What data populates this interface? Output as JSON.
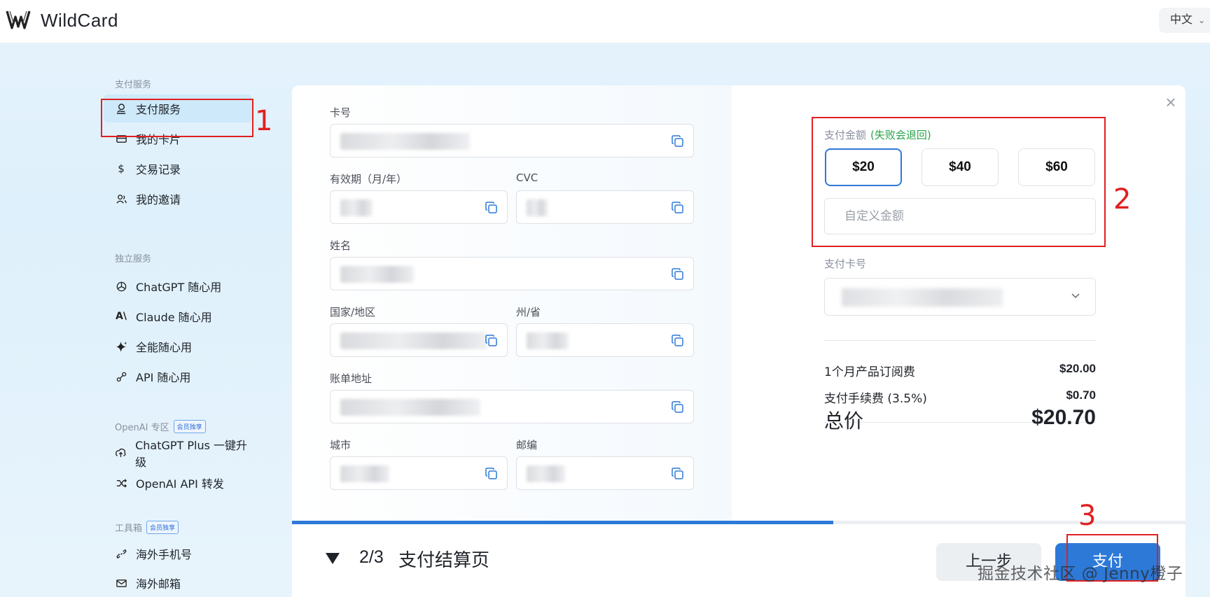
{
  "header": {
    "brand": "WildCard",
    "language": "中文"
  },
  "sidebar": {
    "sections": [
      {
        "title": "支付服务",
        "tag": ""
      },
      {
        "title": "独立服务",
        "tag": ""
      },
      {
        "title": "OpenAI 专区",
        "tag": "会员独享"
      },
      {
        "title": "工具箱",
        "tag": "会员独享"
      }
    ],
    "items": [
      {
        "label": "支付服务",
        "icon": "payment-icon"
      },
      {
        "label": "我的卡片",
        "icon": "card-icon"
      },
      {
        "label": "交易记录",
        "icon": "dollar-icon"
      },
      {
        "label": "我的邀请",
        "icon": "users-icon"
      },
      {
        "label": "ChatGPT 随心用",
        "icon": "openai-icon"
      },
      {
        "label": "Claude 随心用",
        "icon": "anthropic-icon"
      },
      {
        "label": "全能随心用",
        "icon": "sparkle-icon"
      },
      {
        "label": "API 随心用",
        "icon": "api-icon"
      },
      {
        "label": "ChatGPT Plus 一键升级",
        "icon": "upgrade-icon"
      },
      {
        "label": "OpenAI API 转发",
        "icon": "shuffle-icon"
      },
      {
        "label": "海外手机号",
        "icon": "link-icon"
      },
      {
        "label": "海外邮箱",
        "icon": "mail-icon"
      }
    ]
  },
  "annotations": {
    "n1": "1",
    "n2": "2",
    "n3": "3"
  },
  "form": {
    "card_number_label": "卡号",
    "expiry_label": "有效期（月/年）",
    "cvc_label": "CVC",
    "name_label": "姓名",
    "country_label": "国家/地区",
    "state_label": "州/省",
    "address_label": "账单地址",
    "city_label": "城市",
    "zip_label": "邮编"
  },
  "payment": {
    "amount_label": "支付金额",
    "amount_note": "(失败会退回)",
    "amounts": [
      "$20",
      "$40",
      "$60"
    ],
    "selected_amount": "$20",
    "custom_placeholder": "自定义金额",
    "card_label": "支付卡号",
    "summary": [
      {
        "label": "1个月产品订阅费",
        "value": "$20.00"
      },
      {
        "label": "支付手续费 (3.5%)",
        "value": "$0.70"
      }
    ],
    "total_label": "总价",
    "total_value": "$20.70"
  },
  "step": {
    "count": "2/3",
    "title": "支付结算页",
    "progress": 0.606
  },
  "buttons": {
    "prev": "上一步",
    "pay": "支付"
  },
  "watermark": "掘金技术社区 @ Jenny橙子",
  "colors": {
    "accent": "#2d79d8",
    "annotation": "#e02020",
    "note_green": "#28a44a"
  }
}
